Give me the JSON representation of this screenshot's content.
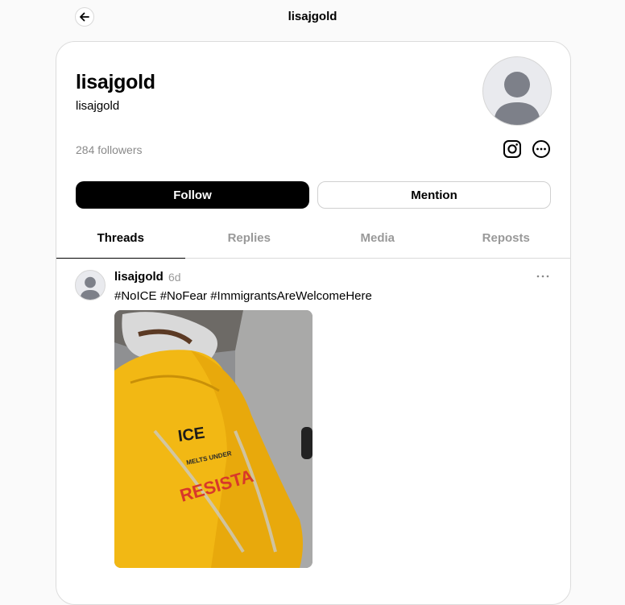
{
  "header": {
    "title": "lisajgold"
  },
  "profile": {
    "display_name": "lisajgold",
    "username": "lisajgold",
    "followers": "284 followers"
  },
  "actions": {
    "follow_label": "Follow",
    "mention_label": "Mention"
  },
  "tabs": [
    {
      "label": "Threads",
      "active": true
    },
    {
      "label": "Replies",
      "active": false
    },
    {
      "label": "Media",
      "active": false
    },
    {
      "label": "Reposts",
      "active": false
    }
  ],
  "post": {
    "author": "lisajgold",
    "time": "6d",
    "text": "#NoICE #NoFear #ImmigrantsAreWelcomeHere",
    "image_lettering": [
      "ICE",
      "MELTS UNDER",
      "RESISTA"
    ]
  },
  "icons": {
    "back": "arrow-left-icon",
    "instagram": "instagram-icon",
    "more": "more-circle-icon",
    "post_more": "ellipsis-icon",
    "avatar": "default-avatar-icon"
  },
  "colors": {
    "primary_button": "#000000",
    "muted_text": "#999999",
    "background": "#fafafa",
    "raincoat": "#f2b814"
  }
}
